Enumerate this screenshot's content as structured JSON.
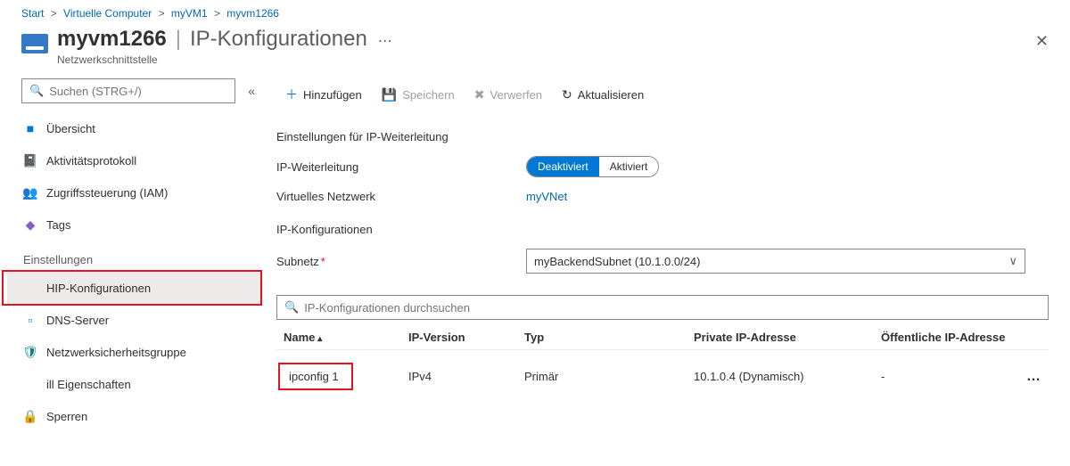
{
  "breadcrumb": {
    "start": "Start",
    "virtual_computers": "Virtuelle Computer",
    "vm": "myVM1",
    "nic": "myvm1266"
  },
  "header": {
    "resource_name": "myvm1266",
    "blade_title": "IP-Konfigurationen",
    "resource_type": "Netzwerkschnittstelle"
  },
  "sidebar": {
    "search_placeholder": "Suchen (STRG+/)",
    "items_top": [
      {
        "label": "Übersicht"
      },
      {
        "label": "Aktivitätsprotokoll"
      },
      {
        "label": "Zugriffssteuerung (IAM)"
      },
      {
        "label": "Tags"
      }
    ],
    "settings_label": "Einstellungen",
    "items_settings": [
      {
        "label": "HIP-Konfigurationen"
      },
      {
        "label": "DNS-Server"
      },
      {
        "label": "Netzwerksicherheitsgruppe"
      },
      {
        "label": "ill Eigenschaften"
      },
      {
        "label": "Sperren"
      }
    ]
  },
  "toolbar": {
    "add": "Hinzufügen",
    "save": "Speichern",
    "discard": "Verwerfen",
    "refresh": "Aktualisieren"
  },
  "form": {
    "forwarding_section": "Einstellungen für IP-Weiterleitung",
    "forwarding_label": "IP-Weiterleitung",
    "toggle_disabled": "Deaktiviert",
    "toggle_enabled": "Aktiviert",
    "vnet_label": "Virtuelles Netzwerk",
    "vnet_value": "myVNet",
    "ipconfig_section": "IP-Konfigurationen",
    "subnet_label": "Subnetz",
    "subnet_value": "myBackendSubnet (10.1.0.0/24)"
  },
  "config_search": {
    "placeholder": "IP-Konfigurationen durchsuchen"
  },
  "table": {
    "headers": {
      "name": "Name",
      "ip_version": "IP-Version",
      "type": "Typ",
      "private_ip": "Private IP-Adresse",
      "public_ip": "Öffentliche IP-Adresse"
    },
    "rows": [
      {
        "name": "ipconfig 1",
        "ip_version": "IPv4",
        "type": "Primär",
        "private_ip": "10.1.0.4 (Dynamisch)",
        "public_ip": "-"
      }
    ]
  }
}
